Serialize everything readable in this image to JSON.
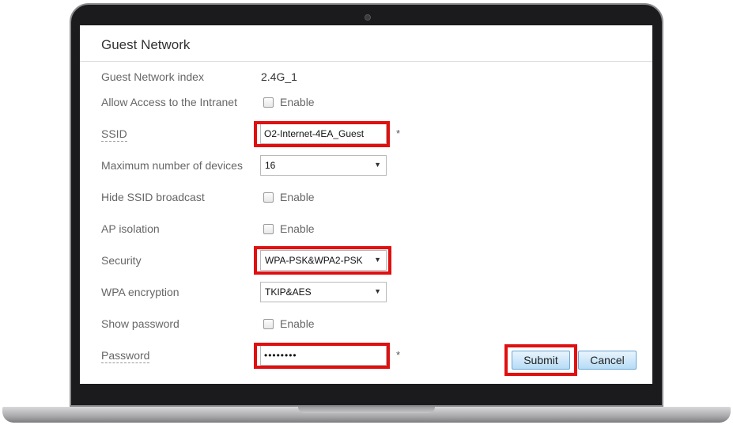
{
  "section_title": "Guest Network",
  "rows": {
    "guest_index": {
      "label": "Guest Network index",
      "value": "2.4G_1"
    },
    "intranet": {
      "label": "Allow Access to the Intranet",
      "option": "Enable",
      "checked": false
    },
    "ssid": {
      "label": "SSID",
      "value": "O2-Internet-4EA_Guest",
      "required": "*"
    },
    "max_devices": {
      "label": "Maximum number of devices",
      "selected": "16"
    },
    "hide_ssid": {
      "label": "Hide SSID broadcast",
      "option": "Enable",
      "checked": false
    },
    "ap_isolation": {
      "label": "AP isolation",
      "option": "Enable",
      "checked": false
    },
    "security": {
      "label": "Security",
      "selected": "WPA-PSK&WPA2-PSK"
    },
    "wpa_encryption": {
      "label": "WPA encryption",
      "selected": "TKIP&AES"
    },
    "show_password": {
      "label": "Show password",
      "option": "Enable",
      "checked": false
    },
    "password": {
      "label": "Password",
      "value": "••••••••",
      "required": "*"
    }
  },
  "buttons": {
    "submit": "Submit",
    "cancel": "Cancel"
  },
  "icons": {
    "select_arrow": "▼"
  },
  "colors": {
    "highlight": "#e01010",
    "button_fill": "#b6dcf6",
    "frame": "#1b1b1d"
  }
}
